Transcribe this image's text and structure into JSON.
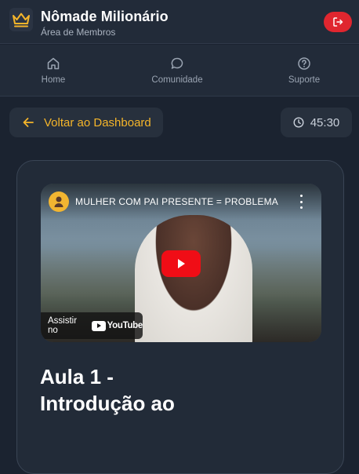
{
  "header": {
    "title": "Nômade Milionário",
    "subtitle": "Área de Membros",
    "logo_icon": "crown-icon",
    "logout_icon": "logout-icon",
    "accent": "#f5b52a",
    "logout_color": "#e0262f"
  },
  "nav": {
    "items": [
      {
        "label": "Home",
        "icon": "home-icon"
      },
      {
        "label": "Comunidade",
        "icon": "chat-bubble-icon"
      },
      {
        "label": "Suporte",
        "icon": "help-circle-icon"
      }
    ]
  },
  "toolbar": {
    "back_label": "Voltar ao Dashboard",
    "back_icon": "arrow-left-icon",
    "timer": "45:30",
    "timer_icon": "clock-icon"
  },
  "video": {
    "title": "MULHER COM PAI PRESENTE = PROBLEMA",
    "watch_on": "Assistir no",
    "brand": "YouTube",
    "play_color": "#f00d16"
  },
  "lesson": {
    "title": "Aula 1 - Introdução ao"
  }
}
